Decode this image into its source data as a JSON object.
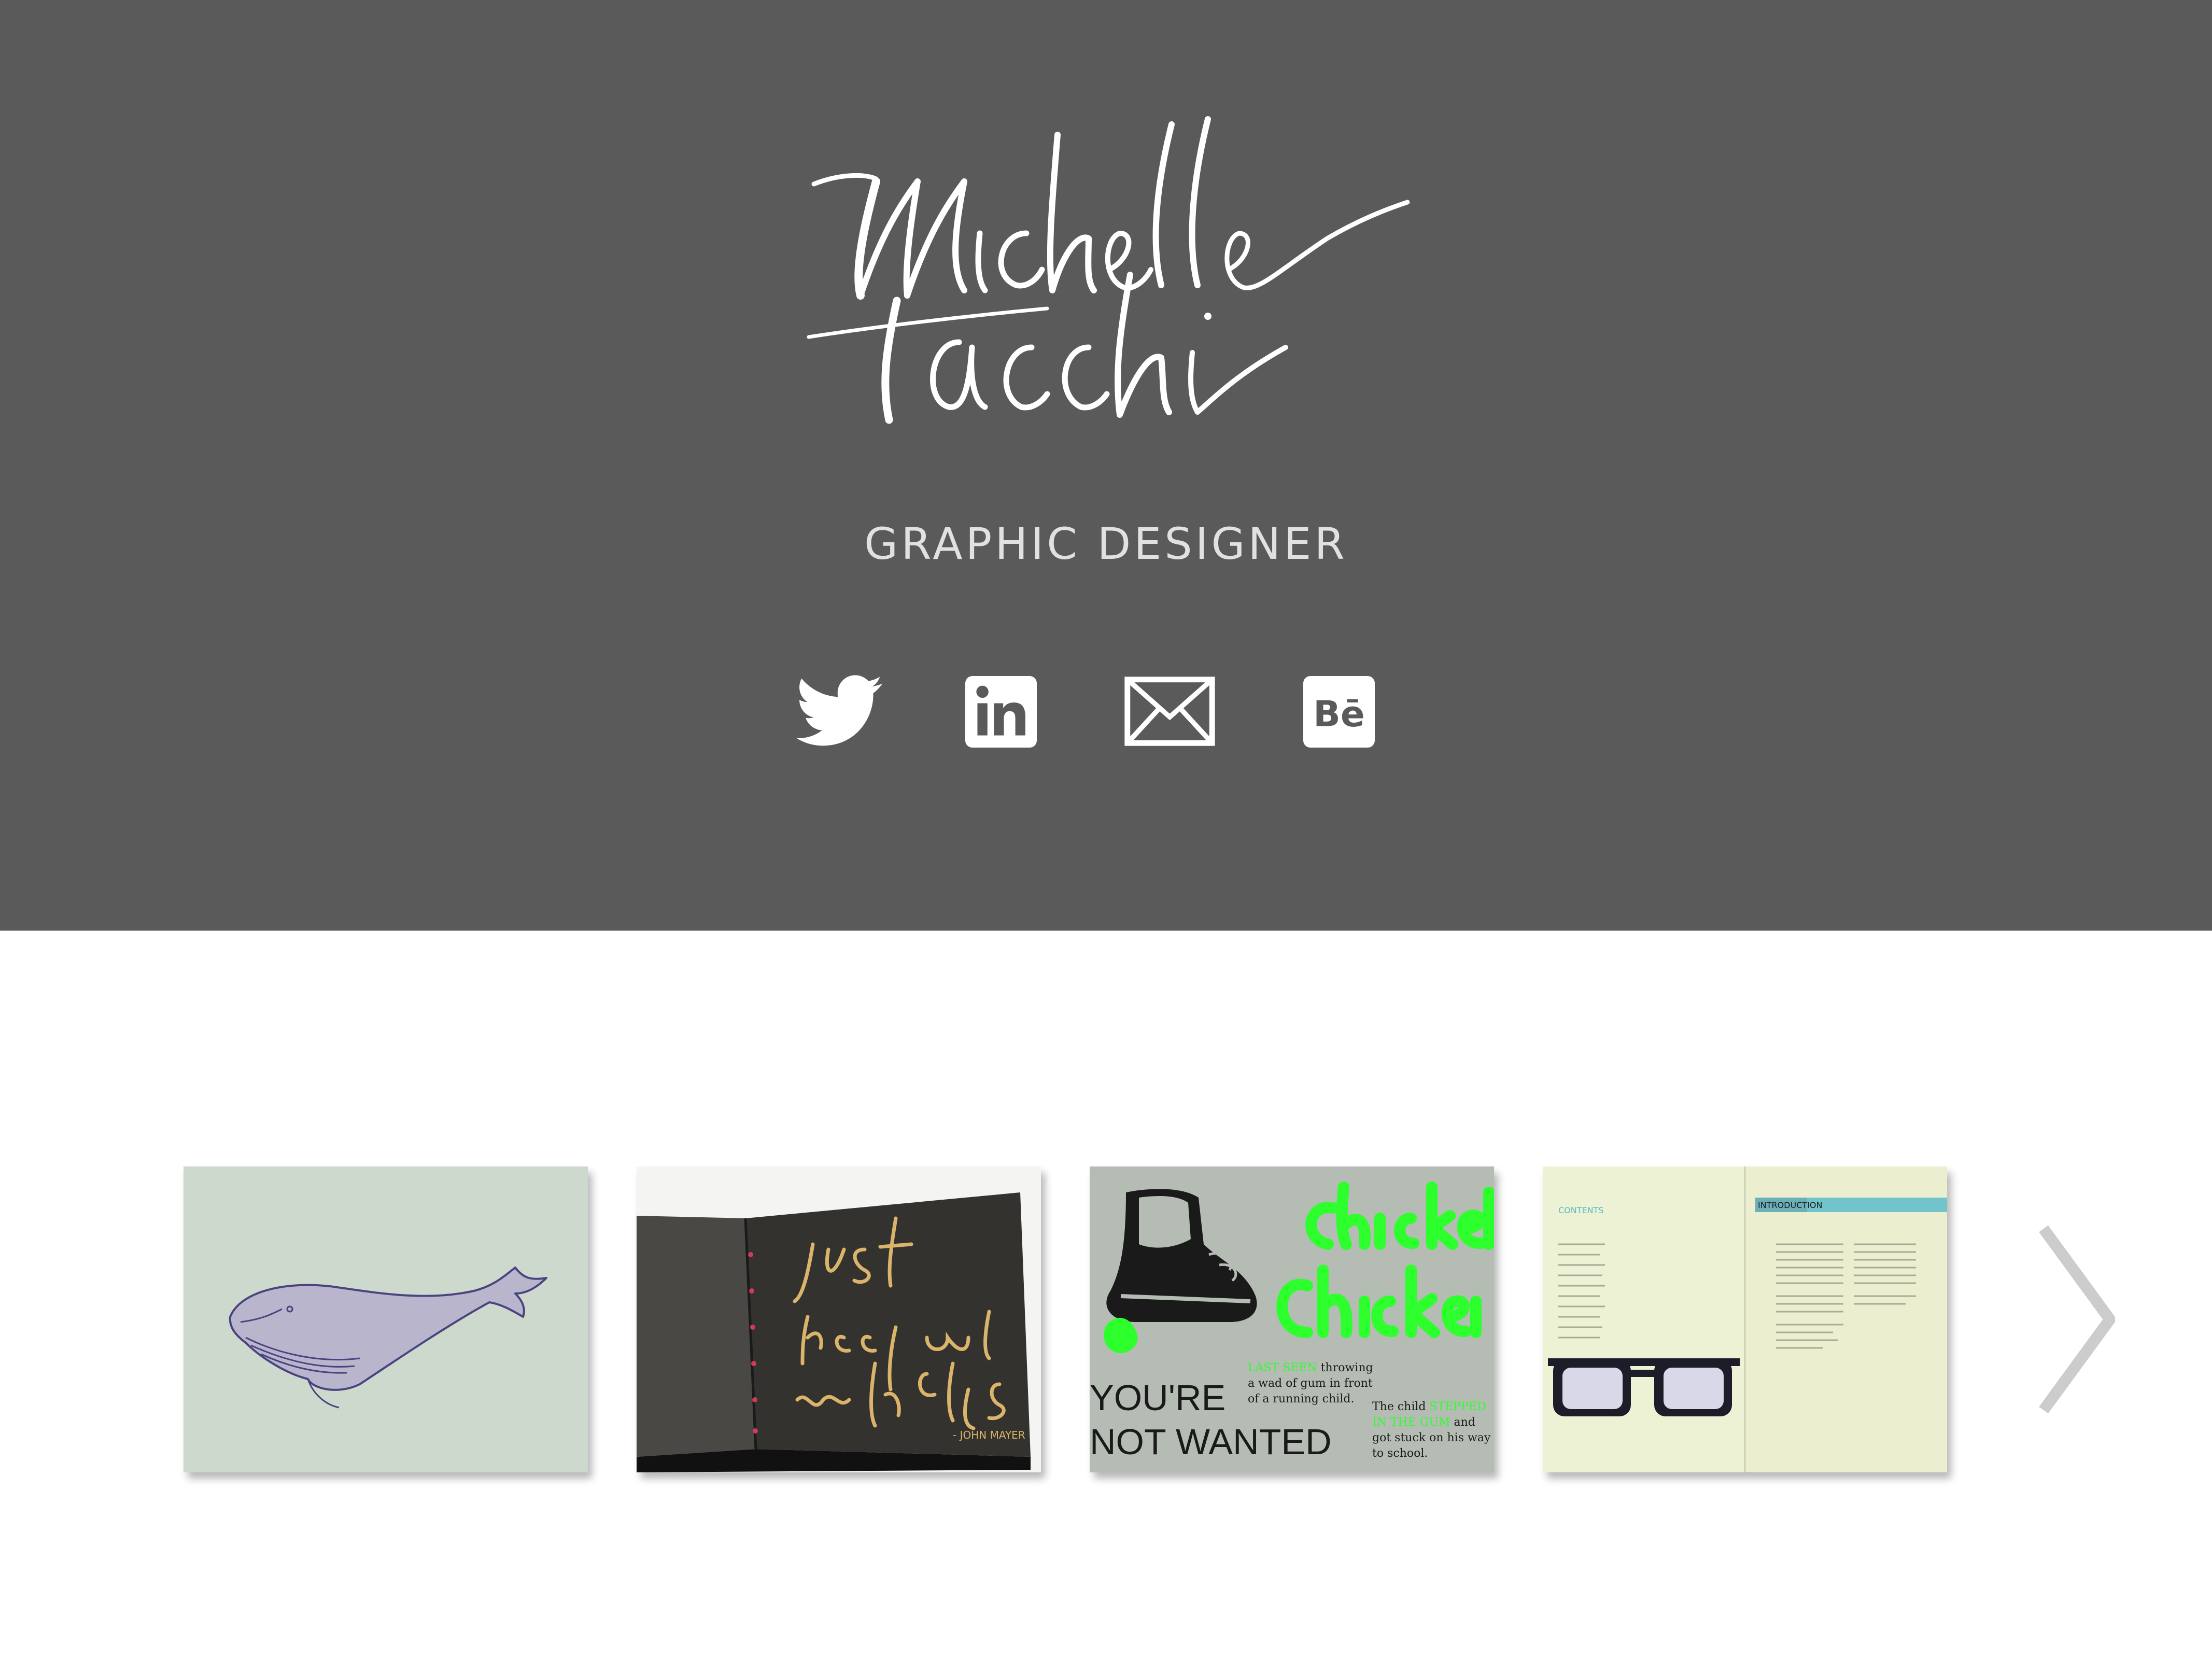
{
  "header": {
    "logo_text": "Michelle Tacchi",
    "tagline": "GRAPHIC DESIGNER"
  },
  "social": [
    {
      "name": "twitter",
      "icon": "twitter-bird-icon"
    },
    {
      "name": "linkedin",
      "icon": "linkedin-icon",
      "label": "in"
    },
    {
      "name": "email",
      "icon": "envelope-icon"
    },
    {
      "name": "behance",
      "icon": "behance-icon",
      "label": "Bē"
    }
  ],
  "gallery": {
    "items": [
      {
        "subject": "whale illustration"
      },
      {
        "subject": "calligraphy book",
        "quote": "just keep me where the light is",
        "attribution": "- JOHN MAYER"
      },
      {
        "subject": "poster",
        "headline": "Chicket Chicken",
        "big_text_1": "YOU'RE",
        "big_text_2": "NOT WANTED",
        "caption_1": "LAST SEEN throwing a wad of gum in front of a running child.",
        "caption_2": "The child STEPPED IN THE GUM and got stuck on his way to school."
      },
      {
        "subject": "booklet spread",
        "left_heading": "CONTENTS",
        "right_heading": "INTRODUCTION"
      }
    ],
    "next_icon": "chevron-right-icon"
  },
  "colors": {
    "header_bg": "#5a5a5a",
    "text_light": "#e1e1e1",
    "icon": "#ffffff",
    "arrow": "#cccccc",
    "neon_green": "#2dff2d"
  }
}
